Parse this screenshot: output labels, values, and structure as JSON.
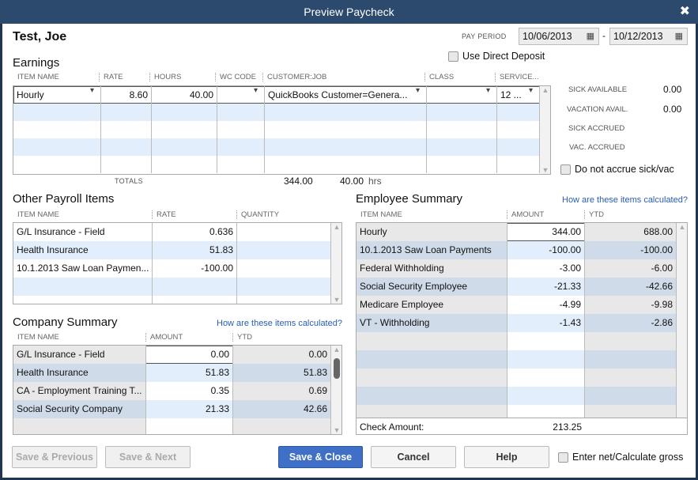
{
  "window": {
    "title": "Preview Paycheck",
    "close_icon": "close-icon"
  },
  "employee": "Test, Joe",
  "pay_period": {
    "label": "PAY PERIOD",
    "from": "10/06/2013",
    "separator": "-",
    "to": "10/12/2013"
  },
  "direct_deposit": {
    "label": "Use Direct Deposit",
    "checked": false
  },
  "earnings": {
    "title": "Earnings",
    "columns": [
      "ITEM NAME",
      "RATE",
      "HOURS",
      "WC CODE",
      "CUSTOMER:JOB",
      "CLASS",
      "SERVICE..."
    ],
    "rows": [
      [
        "Hourly",
        "8.60",
        "40.00",
        "",
        "QuickBooks Customer=Genera...",
        "",
        "12 ..."
      ]
    ],
    "totals_label": "TOTALS",
    "total_amount": "344.00",
    "total_hours": "40.00",
    "hours_unit": "hrs"
  },
  "accruals": {
    "sick_available_label": "SICK AVAILABLE",
    "sick_available": "0.00",
    "vacation_avail_label": "VACATION AVAIL.",
    "vacation_avail": "0.00",
    "sick_accrued_label": "SICK ACCRUED",
    "vac_accrued_label": "VAC. ACCRUED",
    "do_not_accrue_label": "Do not accrue sick/vac",
    "do_not_accrue_checked": false
  },
  "other_payroll": {
    "title": "Other Payroll Items",
    "columns": [
      "ITEM NAME",
      "RATE",
      "QUANTITY"
    ],
    "rows": [
      [
        "G/L Insurance - Field",
        "0.636",
        ""
      ],
      [
        "Health Insurance",
        "51.83",
        ""
      ],
      [
        "10.1.2013 Saw Loan Paymen...",
        "-100.00",
        ""
      ]
    ]
  },
  "company_summary": {
    "title": "Company Summary",
    "link": "How are these items calculated?",
    "columns": [
      "ITEM NAME",
      "AMOUNT",
      "YTD"
    ],
    "rows": [
      [
        "G/L Insurance - Field",
        "0.00",
        "0.00"
      ],
      [
        "Health Insurance",
        "51.83",
        "51.83"
      ],
      [
        "CA - Employment Training T...",
        "0.35",
        "0.69"
      ],
      [
        "Social Security Company",
        "21.33",
        "42.66"
      ]
    ]
  },
  "employee_summary": {
    "title": "Employee Summary",
    "link": "How are these items calculated?",
    "columns": [
      "ITEM NAME",
      "AMOUNT",
      "YTD"
    ],
    "rows": [
      [
        "Hourly",
        "344.00",
        "688.00"
      ],
      [
        "10.1.2013 Saw Loan Payments",
        "-100.00",
        "-100.00"
      ],
      [
        "Federal Withholding",
        "-3.00",
        "-6.00"
      ],
      [
        "Social Security Employee",
        "-21.33",
        "-42.66"
      ],
      [
        "Medicare Employee",
        "-4.99",
        "-9.98"
      ],
      [
        "VT - Withholding",
        "-1.43",
        "-2.86"
      ]
    ],
    "check_amount_label": "Check Amount:",
    "check_amount": "213.25"
  },
  "buttons": {
    "save_previous": "Save & Previous",
    "save_next": "Save & Next",
    "save_close": "Save & Close",
    "cancel": "Cancel",
    "help": "Help"
  },
  "enter_net": {
    "label": "Enter net/Calculate gross",
    "checked": false
  }
}
